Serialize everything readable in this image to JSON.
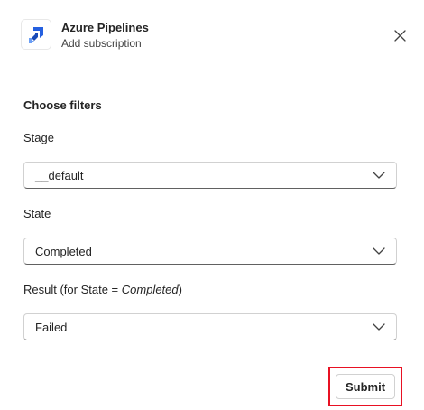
{
  "header": {
    "app_name": "Azure Pipelines",
    "subtitle": "Add subscription",
    "app_icon": "azure-pipelines-icon",
    "close_icon": "close-icon"
  },
  "form": {
    "section_title": "Choose filters",
    "stage": {
      "label": "Stage",
      "value": "__default"
    },
    "state": {
      "label": "State",
      "value": "Completed"
    },
    "result": {
      "label_prefix": "Result (for State = ",
      "label_state": "Completed",
      "label_suffix": ")",
      "value": "Failed"
    }
  },
  "actions": {
    "submit_label": "Submit"
  },
  "colors": {
    "brand_blue": "#2560e0",
    "highlight_red": "#e81123",
    "text": "#242424",
    "border": "#d1d1d1"
  }
}
